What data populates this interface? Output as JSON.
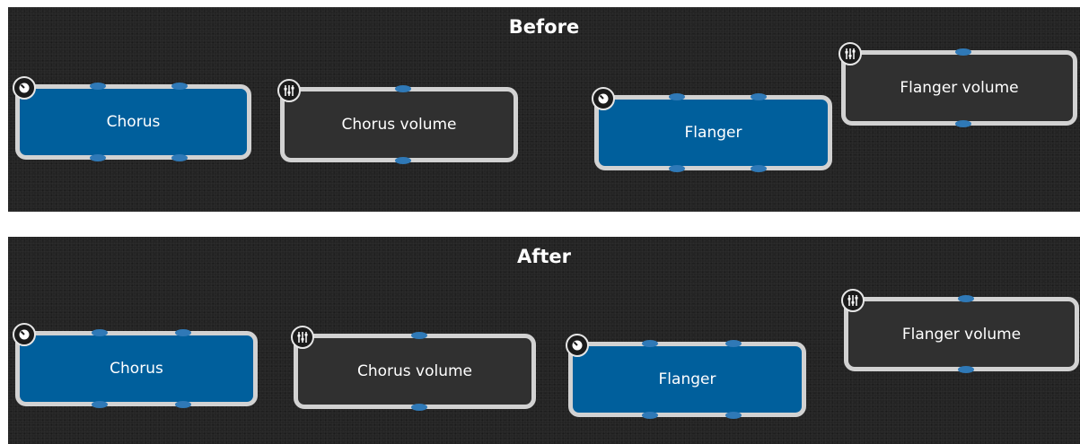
{
  "panels": [
    {
      "title": "Before",
      "nodes": [
        {
          "label": "Chorus",
          "icon": "knob-icon"
        },
        {
          "label": "Chorus volume",
          "icon": "mixer-sliders-icon"
        },
        {
          "label": "Flanger",
          "icon": "knob-icon"
        },
        {
          "label": "Flanger volume",
          "icon": "mixer-sliders-icon"
        }
      ]
    },
    {
      "title": "After",
      "nodes": [
        {
          "label": "Chorus",
          "icon": "knob-icon"
        },
        {
          "label": "Chorus volume",
          "icon": "mixer-sliders-icon"
        },
        {
          "label": "Flanger",
          "icon": "knob-icon"
        },
        {
          "label": "Flanger volume",
          "icon": "mixer-sliders-icon"
        }
      ]
    }
  ],
  "colors": {
    "panel_background": "#242424",
    "effect_node": "#005f9c",
    "volume_node": "#303030",
    "node_border": "#d2d2d2",
    "port": "#2f79b7",
    "text": "#ffffff"
  }
}
